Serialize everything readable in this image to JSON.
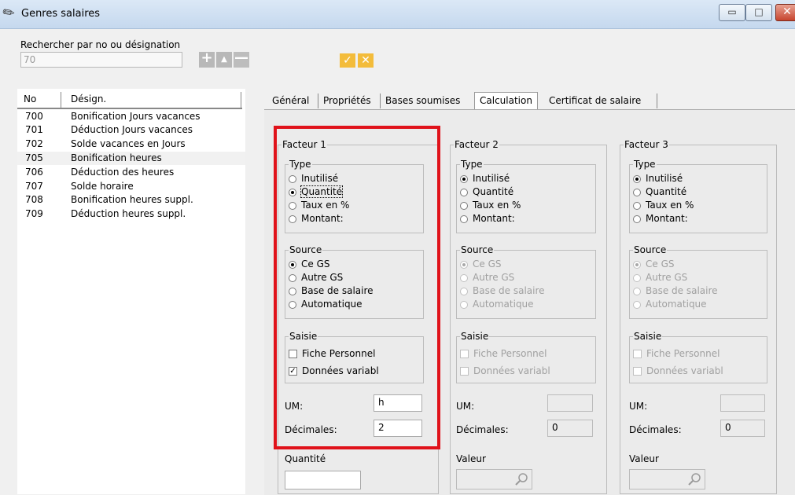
{
  "window": {
    "title": "Genres salaires",
    "icon": "pen-icon",
    "min_glyph": "▭",
    "max_glyph": "□",
    "close_glyph": "✕"
  },
  "search": {
    "label": "Rechercher par no ou désignation",
    "value": "70",
    "add_glyph": "+",
    "up_glyph": "▲",
    "remove_glyph": "—",
    "ok_glyph": "✓",
    "cancel_glyph": "✕"
  },
  "list": {
    "headers": {
      "no": "No",
      "designation": "Désign."
    },
    "rows": [
      {
        "no": "700",
        "designation": "Bonification Jours vacances"
      },
      {
        "no": "701",
        "designation": "Déduction Jours vacances"
      },
      {
        "no": "702",
        "designation": "Solde vacances en Jours"
      },
      {
        "no": "705",
        "designation": "Bonification heures"
      },
      {
        "no": "706",
        "designation": "Déduction des heures"
      },
      {
        "no": "707",
        "designation": "Solde horaire"
      },
      {
        "no": "708",
        "designation": "Bonification heures suppl."
      },
      {
        "no": "709",
        "designation": "Déduction heures suppl."
      }
    ],
    "selected_no": "705"
  },
  "tabs": [
    "Général",
    "Propriétés",
    "Bases soumises",
    "Calculation",
    "Certificat de salaire"
  ],
  "active_tab": "Calculation",
  "labels": {
    "type": "Type",
    "source": "Source",
    "saisie": "Saisie",
    "um": "UM:",
    "decimales": "Décimales:",
    "opt_inutilise": "Inutilisé",
    "opt_quantite": "Quantité",
    "opt_taux": "Taux en %",
    "opt_montant": "Montant:",
    "src_ce_gs": "Ce GS",
    "src_autre_gs": "Autre GS",
    "src_base": "Base de salaire",
    "src_auto": "Automatique",
    "sai_fiche": "Fiche Personnel",
    "sai_donnees": "Données variabl"
  },
  "facteurs": [
    {
      "title": "Facteur 1",
      "type": "Quantité",
      "source": "Ce GS",
      "fiche_personnel": false,
      "donnees_variables": true,
      "um": "h",
      "decimales": "2",
      "footer_label": "Quantité",
      "footer_value": ""
    },
    {
      "title": "Facteur 2",
      "type": "Inutilisé",
      "source": "Ce GS",
      "fiche_personnel": false,
      "donnees_variables": false,
      "um": "",
      "decimales": "0",
      "footer_label": "Valeur",
      "footer_value": ""
    },
    {
      "title": "Facteur 3",
      "type": "Inutilisé",
      "source": "Ce GS",
      "fiche_personnel": false,
      "donnees_variables": false,
      "um": "",
      "decimales": "0",
      "footer_label": "Valeur",
      "footer_value": ""
    }
  ],
  "colors": {
    "highlight": "#e0121a",
    "action_button": "#f3bc3b"
  }
}
